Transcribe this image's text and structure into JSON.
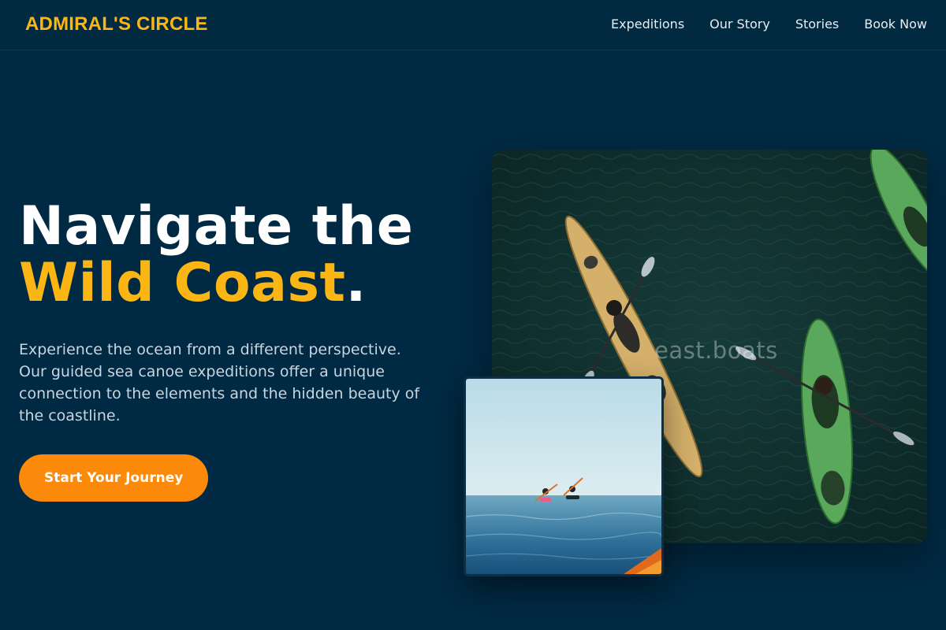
{
  "brand": {
    "name": "ADMIRAL'S CIRCLE"
  },
  "nav": {
    "items": [
      {
        "label": "Expeditions"
      },
      {
        "label": "Our Story"
      },
      {
        "label": "Stories"
      },
      {
        "label": "Book Now"
      }
    ]
  },
  "hero": {
    "headline_line1": "Navigate the",
    "headline_accent": "Wild Coast",
    "headline_punct": ".",
    "description": "Experience the ocean from a different perspective. Our guided sea canoe expeditions offer a unique connection to the elements and the hidden beauty of the coastline.",
    "cta_label": "Start Your Journey"
  },
  "images": {
    "main_watermark": "east.boats"
  },
  "colors": {
    "background": "#002a43",
    "accent": "#fbb615",
    "cta": "#fb8a0a",
    "text": "#ffffff"
  }
}
